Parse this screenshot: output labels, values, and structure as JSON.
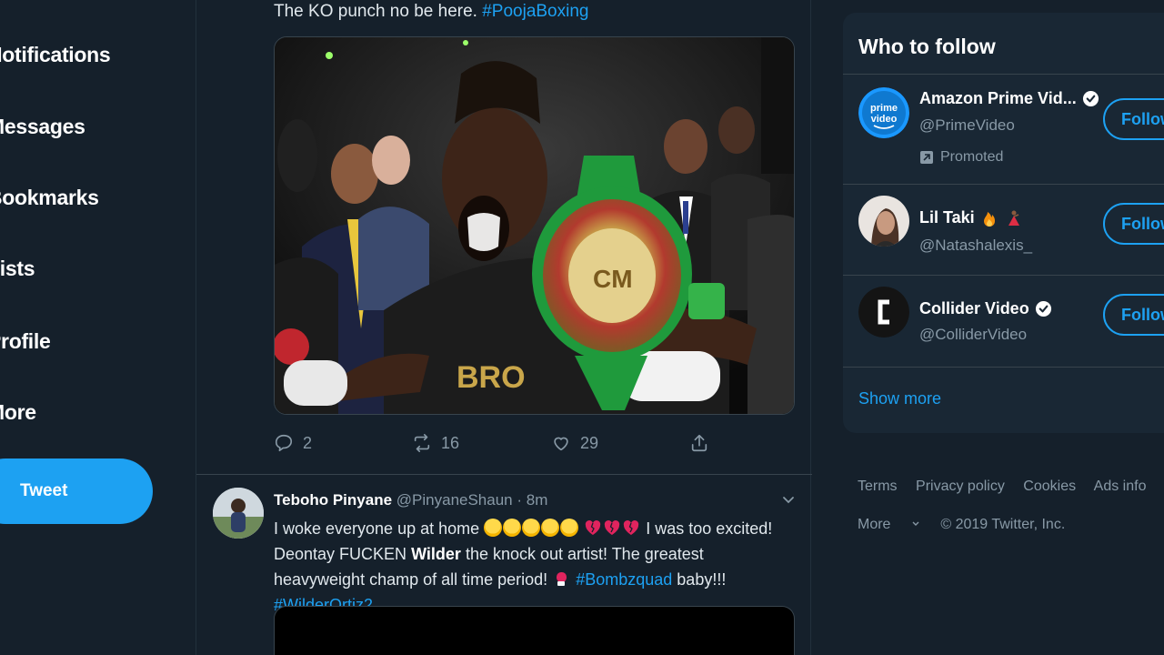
{
  "nav": {
    "items": [
      {
        "label": "Notifications"
      },
      {
        "label": "Messages"
      },
      {
        "label": "Bookmarks"
      },
      {
        "label": "Lists"
      },
      {
        "label": "Profile"
      },
      {
        "label": "More"
      }
    ],
    "tweet_button": "Tweet"
  },
  "tweet1": {
    "text": "The KO punch no be here.",
    "hashtag": "#PoojaBoxing",
    "reply_count": "2",
    "retweet_count": "16",
    "like_count": "29"
  },
  "tweet2": {
    "name": "Teboho Pinyane",
    "handle": "@PinyaneShaun",
    "time": "· 8m",
    "body_part1": "I woke everyone up at home",
    "body_part2": "I was too excited! Deontay FUCKEN",
    "body_bold": "Wilder",
    "body_part3": "the knock out artist! The greatest heavyweight champ of all time period!",
    "hashtag1": "#Bombzquad",
    "body_part4": "baby!!!",
    "hashtag2": "#WilderOrtiz2"
  },
  "sidebar": {
    "title": "Who to follow",
    "accounts": [
      {
        "name": "Amazon Prime Vid...",
        "handle": "@PrimeVideo",
        "promoted": "Promoted",
        "button": "Follow"
      },
      {
        "name": "Lil Taki",
        "handle": "@Natashalexis_",
        "button": "Follow"
      },
      {
        "name": "Collider Video",
        "handle": "@ColliderVideo",
        "button": "Follow"
      }
    ],
    "show_more": "Show more"
  },
  "footer": {
    "links": [
      "Terms",
      "Privacy policy",
      "Cookies",
      "Ads info"
    ],
    "more": "More",
    "copyright": "© 2019 Twitter, Inc."
  },
  "colors": {
    "background": "#15202b",
    "panel": "#192734",
    "accent": "#1da1f2",
    "muted": "#8899a6"
  }
}
